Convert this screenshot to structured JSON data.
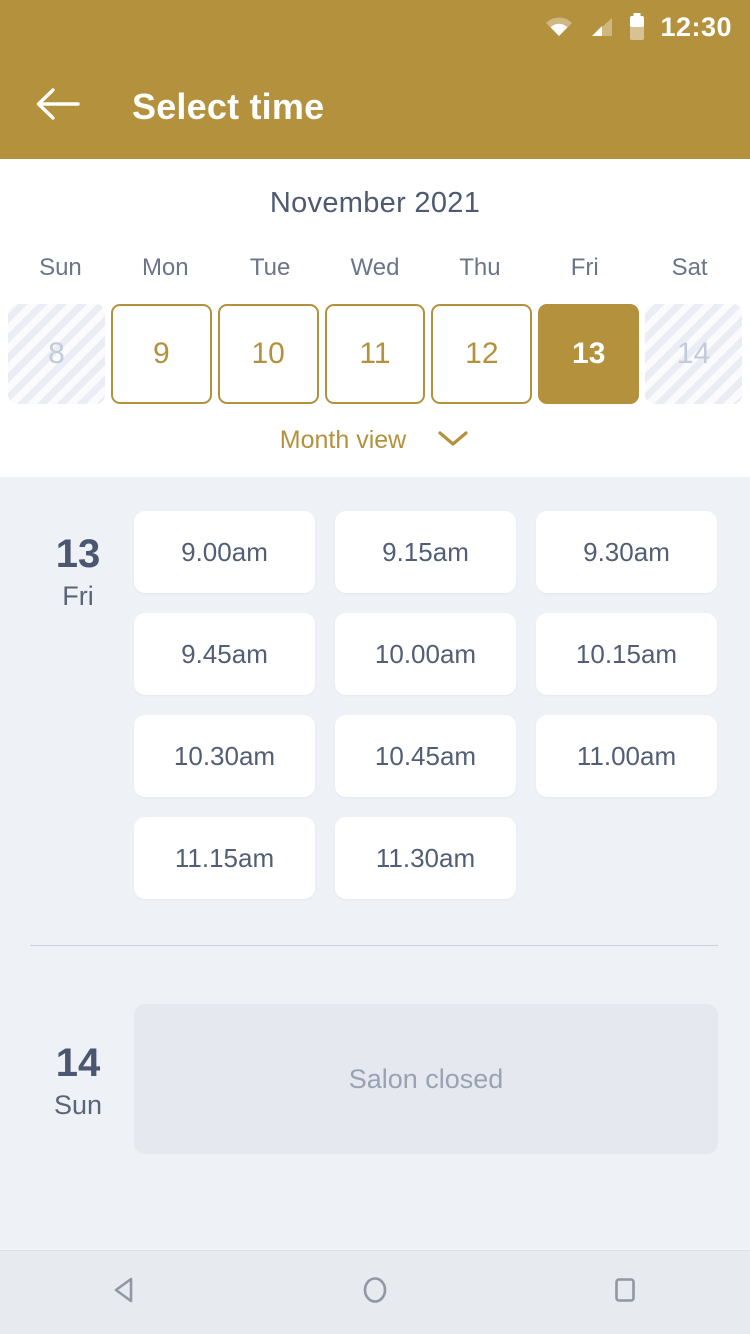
{
  "status_bar": {
    "time": "12:30",
    "icons": [
      "wifi-icon",
      "cellular-signal-icon",
      "battery-icon"
    ]
  },
  "app_bar": {
    "back_icon": "arrow-left-icon",
    "title": "Select time"
  },
  "calendar": {
    "month_title": "November 2021",
    "day_names": [
      "Sun",
      "Mon",
      "Tue",
      "Wed",
      "Thu",
      "Fri",
      "Sat"
    ],
    "days": [
      {
        "number": "8",
        "state": "disabled"
      },
      {
        "number": "9",
        "state": "available"
      },
      {
        "number": "10",
        "state": "available"
      },
      {
        "number": "11",
        "state": "available"
      },
      {
        "number": "12",
        "state": "available"
      },
      {
        "number": "13",
        "state": "selected"
      },
      {
        "number": "14",
        "state": "disabled"
      }
    ],
    "view_toggle_label": "Month view",
    "view_toggle_icon": "chevron-down-icon"
  },
  "schedule": {
    "day_one": {
      "date_number": "13",
      "day_name": "Fri",
      "slots": [
        "9.00am",
        "9.15am",
        "9.30am",
        "9.45am",
        "10.00am",
        "10.15am",
        "10.30am",
        "10.45am",
        "11.00am",
        "11.15am",
        "11.30am"
      ]
    },
    "day_two": {
      "date_number": "14",
      "day_name": "Sun",
      "closed_message": "Salon closed"
    }
  },
  "nav_bar": {
    "back_icon": "triangle-back-icon",
    "home_icon": "circle-home-icon",
    "recents_icon": "square-recents-icon"
  },
  "colors": {
    "accent_gold": "#b4913c",
    "body_bg": "#eef1f6",
    "slot_bg": "#ffffff",
    "closed_bg": "#e5e8ee",
    "text_slate": "#4e5a72",
    "text_muted": "#99a2b4"
  }
}
